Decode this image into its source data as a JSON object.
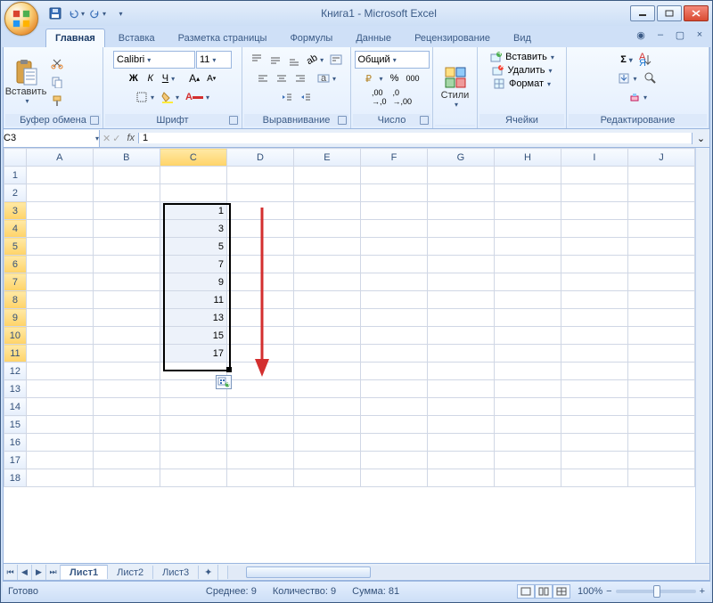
{
  "window": {
    "title": "Книга1 - Microsoft Excel"
  },
  "quickAccess": {
    "save": "save-icon",
    "undo": "undo-icon",
    "redo": "redo-icon"
  },
  "tabs": [
    "Главная",
    "Вставка",
    "Разметка страницы",
    "Формулы",
    "Данные",
    "Рецензирование",
    "Вид"
  ],
  "activeTab": 0,
  "ribbon": {
    "clipboard": {
      "label": "Буфер обмена",
      "paste": "Вставить"
    },
    "font": {
      "label": "Шрифт",
      "family": "Calibri",
      "size": "11"
    },
    "alignment": {
      "label": "Выравнивание"
    },
    "number": {
      "label": "Число",
      "format": "Общий"
    },
    "styles": {
      "label": "Стили"
    },
    "cells": {
      "label": "Ячейки",
      "insert": "Вставить",
      "delete": "Удалить",
      "format": "Формат"
    },
    "editing": {
      "label": "Редактирование"
    }
  },
  "namebox": "C3",
  "formula": "1",
  "columns": [
    "A",
    "B",
    "C",
    "D",
    "E",
    "F",
    "G",
    "H",
    "I",
    "J"
  ],
  "rowCount": 18,
  "selectedColumn": "C",
  "selection": {
    "col": "C",
    "startRow": 3,
    "endRow": 11
  },
  "cellData": {
    "C3": "1",
    "C4": "3",
    "C5": "5",
    "C6": "7",
    "C7": "9",
    "C8": "11",
    "C9": "13",
    "C10": "15",
    "C11": "17"
  },
  "sheets": [
    "Лист1",
    "Лист2",
    "Лист3"
  ],
  "activeSheet": 0,
  "status": {
    "ready": "Готово",
    "average_label": "Среднее:",
    "average": "9",
    "count_label": "Количество:",
    "count": "9",
    "sum_label": "Сумма:",
    "sum": "81",
    "zoom": "100%"
  }
}
